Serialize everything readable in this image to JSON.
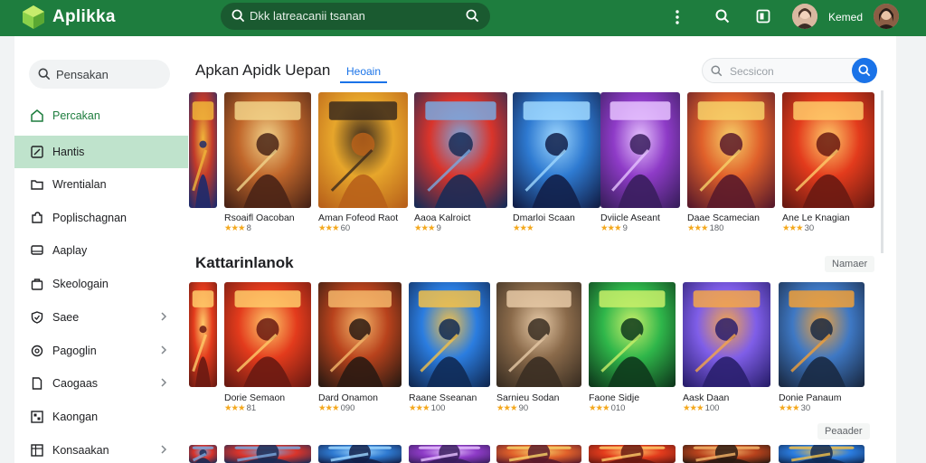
{
  "app": {
    "name": "Aplikka",
    "search_text": "Dkk latreacanii tsanan",
    "user_name": "Kemed",
    "colors": {
      "brand": "#1e7d3e",
      "accent": "#1a73e8",
      "star": "#f4a81d",
      "active": "#bfe3cc"
    },
    "top_icons": [
      "more-vert-icon",
      "search-icon",
      "tablet-icon"
    ]
  },
  "sidebar": {
    "search_label": "Pensakan",
    "items": [
      {
        "label": "Percakan",
        "icon": "home-icon",
        "active": false,
        "green": true,
        "chevron": false
      },
      {
        "label": "Hantis",
        "icon": "edit-box-icon",
        "active": true,
        "green": false,
        "chevron": false
      },
      {
        "label": "Wrentialan",
        "icon": "folder-icon",
        "active": false,
        "green": false,
        "chevron": false
      },
      {
        "label": "Poplischagnan",
        "icon": "puzzle-icon",
        "active": false,
        "green": false,
        "chevron": false
      },
      {
        "label": "Aaplay",
        "icon": "display-icon",
        "active": false,
        "green": false,
        "chevron": false
      },
      {
        "label": "Skeologain",
        "icon": "bag-icon",
        "active": false,
        "green": false,
        "chevron": false
      },
      {
        "label": "Saee",
        "icon": "shield-icon",
        "active": false,
        "green": false,
        "chevron": true
      },
      {
        "label": "Pagoglin",
        "icon": "gear-icon",
        "active": false,
        "green": false,
        "chevron": true
      },
      {
        "label": "Caogaas",
        "icon": "doc-icon",
        "active": false,
        "green": false,
        "chevron": true
      },
      {
        "label": "Kaongan",
        "icon": "grid-icon",
        "active": false,
        "green": false,
        "chevron": false
      },
      {
        "label": "Konsaakan",
        "icon": "table-icon",
        "active": false,
        "green": false,
        "chevron": true
      }
    ]
  },
  "main": {
    "section1": {
      "title": "Apkan Apidk Uepan",
      "tab": "Heoain",
      "search_placeholder": "Secsicon",
      "games": [
        {
          "name": "Rsoaifl Oacoban",
          "rating": "8"
        },
        {
          "name": "Aman Fofeod Raot",
          "rating": "60"
        },
        {
          "name": "Aaoa Kalroict",
          "rating": "9"
        },
        {
          "name": "Dmarloi Scaan",
          "rating": ""
        },
        {
          "name": "Dviicle Aseant",
          "rating": "9"
        },
        {
          "name": "Daae Scamecian",
          "rating": "180"
        },
        {
          "name": "Ane Le Knagian",
          "rating": "30"
        }
      ]
    },
    "section2": {
      "title": "Kattarinlanok",
      "more": "Namaer",
      "more2": "Peaader",
      "games": [
        {
          "name": "Dorie Semaon",
          "rating": "81"
        },
        {
          "name": "Dard Onamon",
          "rating": "090"
        },
        {
          "name": "Raane Sseanan",
          "rating": "100"
        },
        {
          "name": "Sarnieu Sodan",
          "rating": "90"
        },
        {
          "name": "Faone Sidje",
          "rating": "010"
        },
        {
          "name": "Aask Daan",
          "rating": "100"
        },
        {
          "name": "Donie Panaum",
          "rating": "30"
        }
      ]
    }
  }
}
